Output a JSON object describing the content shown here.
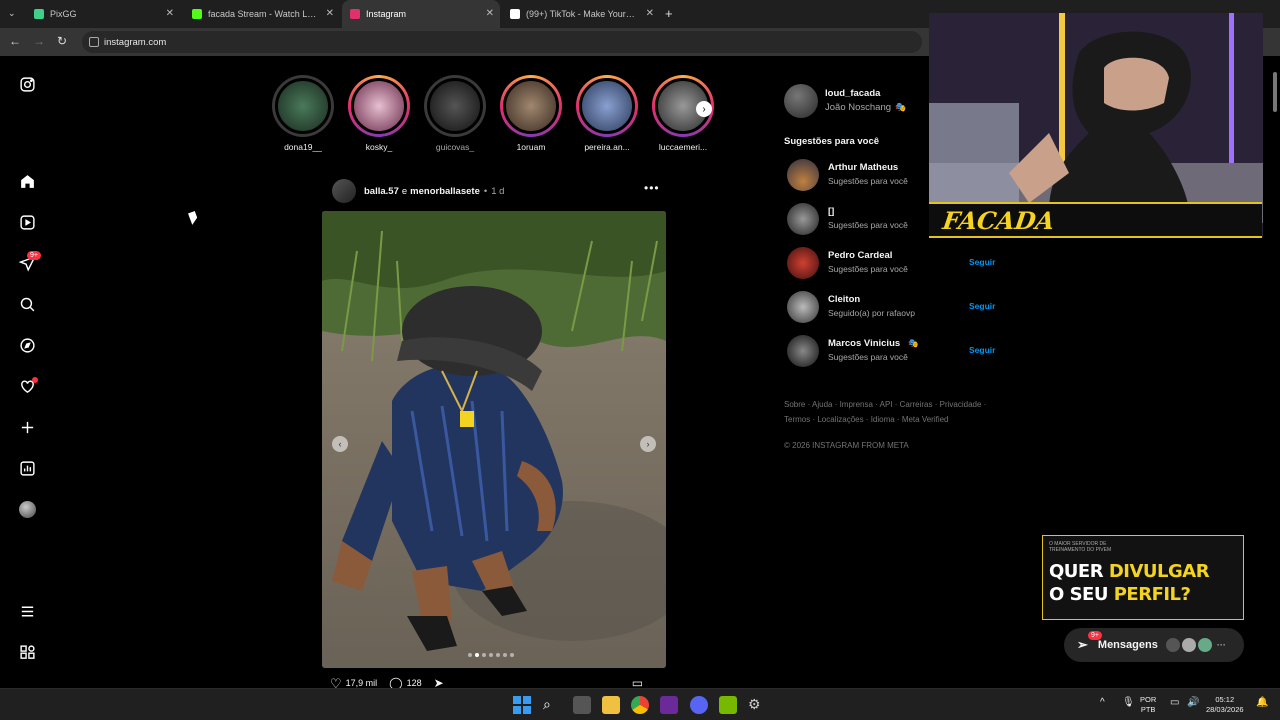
{
  "browser": {
    "tabs": [
      {
        "title": "PixGG",
        "color": "#3fd08a",
        "active": false
      },
      {
        "title": "facada Stream - Watch Live on",
        "color": "#53fc18",
        "active": false
      },
      {
        "title": "Instagram",
        "color": "#e1306c",
        "active": true
      },
      {
        "title": "(99+) TikTok - Make Your Day",
        "color": "#ffffff",
        "active": false
      }
    ],
    "new_tab": "+",
    "url": "instagram.com"
  },
  "instagram": {
    "sidebar": {
      "notifications_badge": "9+"
    },
    "stories": [
      {
        "name": "dona19__",
        "ring": "seen",
        "color": "#2d4a3a"
      },
      {
        "name": "kosky_",
        "ring": "new",
        "color": "#c85a8a"
      },
      {
        "name": "guicovas_",
        "ring": "seen",
        "color": "#2a2a2a"
      },
      {
        "name": "1oruam",
        "ring": "new",
        "color": "#6b5a4a"
      },
      {
        "name": "pereira.an...",
        "ring": "new",
        "color": "#4a6a9a"
      },
      {
        "name": "luccaemeri...",
        "ring": "new",
        "color": "#5a5a5a"
      }
    ],
    "post": {
      "author": "balla.57",
      "joiner": "e",
      "coauthor": "menorballasete",
      "time_sep": "•",
      "time": "1 d",
      "likes": "17,9 mil",
      "comments": "128",
      "carousel_count": 7,
      "carousel_index": 2
    },
    "account": {
      "username": "loud_facada",
      "name": "João Noschang"
    },
    "suggestions_title": "Sugestões para você",
    "suggestions": [
      {
        "name": "Arthur Matheus",
        "sub": "Sugestões para você",
        "follow": ""
      },
      {
        "name": "[]",
        "sub": "Sugestões para você",
        "follow": ""
      },
      {
        "name": "Pedro Cardeal",
        "sub": "Sugestões para você",
        "follow": "Seguir"
      },
      {
        "name": "Cleiton",
        "sub": "Seguido(a) por rafaovp",
        "follow": "Seguir"
      },
      {
        "name": "Marcos Vinicius",
        "sub": "Sugestões para você",
        "follow": "Seguir"
      }
    ],
    "footer": "Sobre · Ajuda · Imprensa · API · Carreiras · Privacidade · Termos · Localizações · Idioma · Meta Verified",
    "copyright": "© 2026 INSTAGRAM FROM META",
    "messages": {
      "label": "Mensagens",
      "badge": "9+"
    }
  },
  "overlay": {
    "cam_logo": "FACADA",
    "ad_small": "O MAIOR SERVIDOR DE TREINAMENTO DO PIVEM",
    "ad_line1_white": "QUER ",
    "ad_line1_yellow": "DIVULGAR",
    "ad_line2_white": "O SEU ",
    "ad_line2_yellow": "PERFIL?",
    "brand_yellow": "#f4d321"
  },
  "taskbar": {
    "lang": "POR",
    "layout": "PTB",
    "time": "05:12",
    "date": "28/03/2026"
  }
}
